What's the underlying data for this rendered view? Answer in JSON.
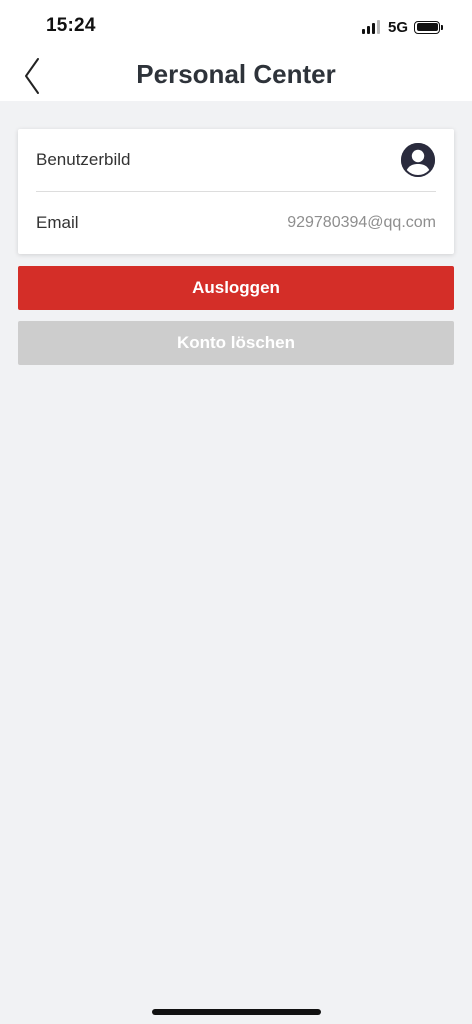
{
  "status_bar": {
    "time": "15:24",
    "network": "5G",
    "signal_bars_active": 3,
    "signal_bars_total": 4,
    "battery_level": 1.0
  },
  "header": {
    "title": "Personal Center",
    "back_icon": "chevron-left-icon"
  },
  "profile": {
    "avatar_label": "Benutzerbild",
    "avatar_icon": "user-avatar-icon",
    "email_label": "Email",
    "email_value": "929780394@qq.com"
  },
  "actions": {
    "logout_label": "Ausloggen",
    "delete_label": "Konto löschen"
  },
  "colors": {
    "accent_red": "#d42e28",
    "disabled_gray": "#cdcdcd",
    "background": "#f1f2f4",
    "title_text": "#2e333a"
  }
}
